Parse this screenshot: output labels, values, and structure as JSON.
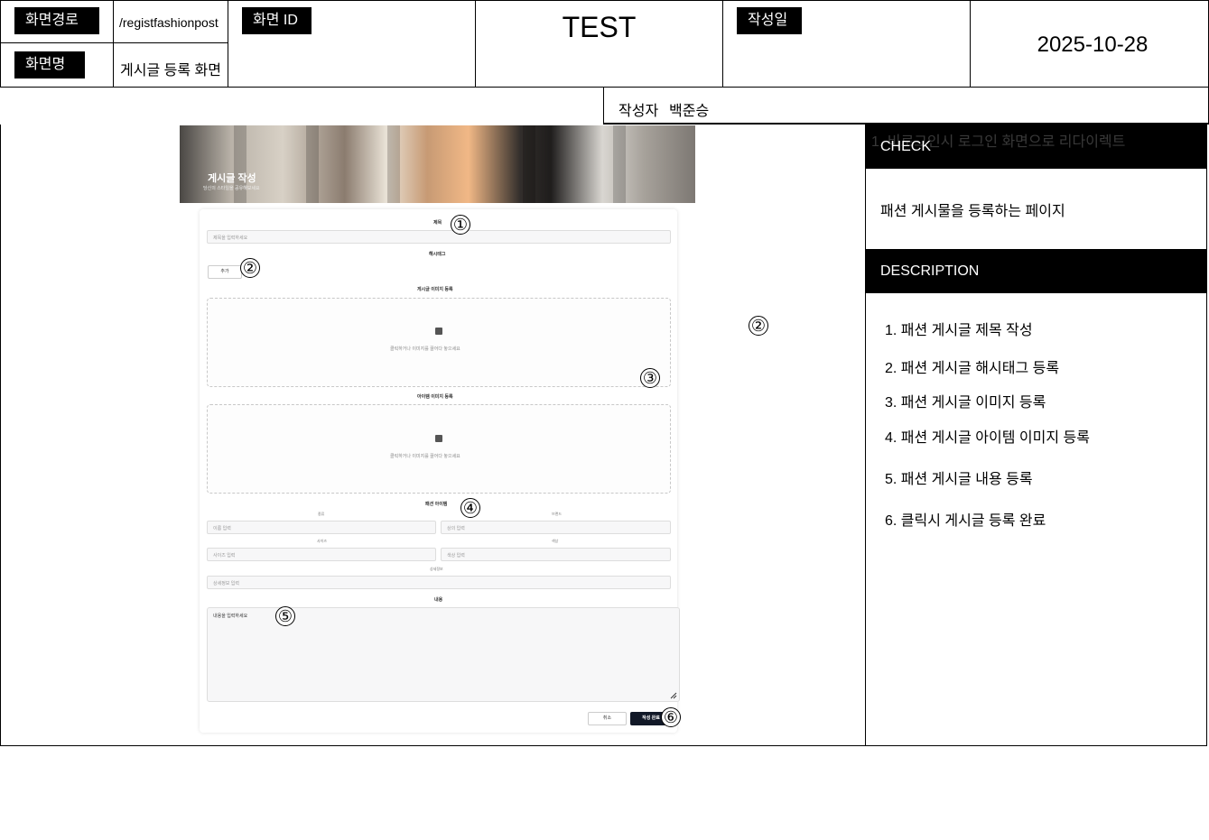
{
  "header": {
    "path_label": "화면경로",
    "path_value": "/registfashionpost",
    "name_label": "화면명",
    "name_value": "게시글 등록 화면",
    "id_label": "화면 ID",
    "center_title": "TEST",
    "date_label": "작성일",
    "date_value": "2025-10-28",
    "author_label": "작성자",
    "author_value": "백준승"
  },
  "mockup": {
    "banner_title": "게시글 작성",
    "banner_subtitle": "당신의 스타일을 공유해보세요",
    "title_label": "제목",
    "title_placeholder": "제목을 입력하세요",
    "hashtag_label": "해시태그",
    "hashtag_add_button": "추가",
    "post_image_label": "게시글 이미지 등록",
    "post_image_hint": "클릭하거나 이미지를 끌어다 놓으세요",
    "item_image_label": "아이템 이미지 등록",
    "item_image_hint": "클릭하거나 이미지를 끌어다 놓으세요",
    "fashion_item_label": "패션 아이템",
    "category_label": "종류",
    "category_placeholder": "이름 입력",
    "brand_label": "브랜드",
    "brand_placeholder": "상의 입력",
    "size_label": "사이즈",
    "size_placeholder": "사이즈 입력",
    "color_label": "색상",
    "color_placeholder": "색상 입력",
    "detail_label": "상세정보",
    "detail_placeholder": "상세정보 입력",
    "content_label": "내용",
    "content_placeholder": "내용을 입력하세요",
    "cancel_button": "취소",
    "submit_button": "작성 완료"
  },
  "markers": [
    "①",
    "②",
    "②",
    "③",
    "④",
    "⑤",
    "⑥"
  ],
  "panel": {
    "overlap_text": "1. 비로그인시 로그인 화면으로 리다이렉트",
    "check_title": "CHECK",
    "check_text": "패션 게시물을 등록하는 페이지",
    "description_title": "DESCRIPTION",
    "items": [
      "1. 패션 게시글 제목 작성",
      "2. 패션 게시글 해시태그 등록",
      "3. 패션 게시글 이미지 등록",
      "4. 패션 게시글 아이템 이미지 등록",
      "5. 패션 게시글 내용 등록",
      "6. 클릭시 게시글 등록 완료"
    ]
  }
}
